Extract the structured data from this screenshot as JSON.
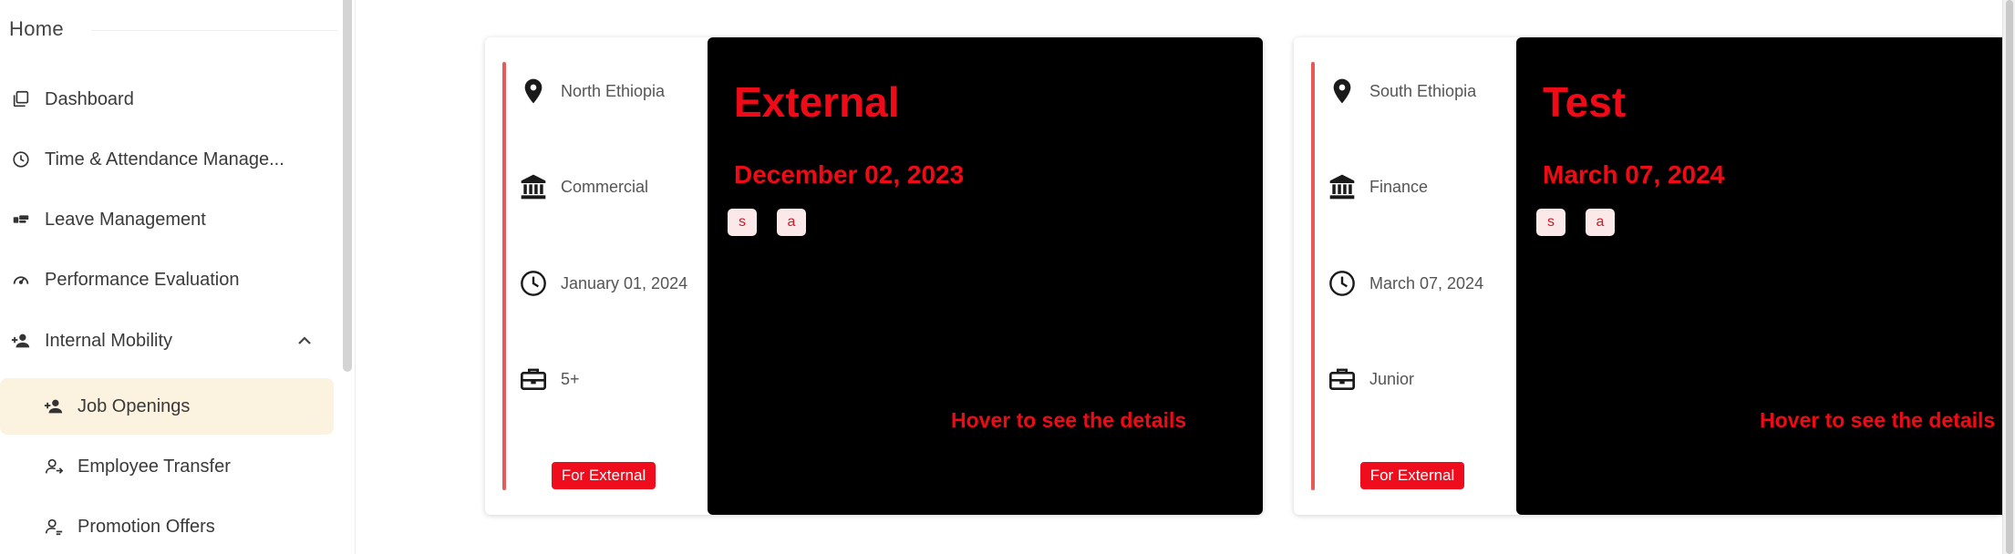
{
  "sidebar": {
    "home_label": "Home",
    "items": [
      {
        "label": "Dashboard",
        "icon": "dashboard-icon"
      },
      {
        "label": "Time & Attendance Manage...",
        "icon": "clock-icon"
      },
      {
        "label": "Leave Management",
        "icon": "leave-icon"
      },
      {
        "label": "Performance Evaluation",
        "icon": "gauge-icon"
      },
      {
        "label": "Internal Mobility",
        "icon": "person-add-icon",
        "expanded": true
      },
      {
        "label": "Job Openings",
        "icon": "person-add-icon",
        "active": true
      },
      {
        "label": "Employee Transfer",
        "icon": "person-transfer-icon"
      },
      {
        "label": "Promotion Offers",
        "icon": "person-promotion-icon"
      }
    ],
    "active_color": "#fbf3df"
  },
  "cards": [
    {
      "location": "North Ethiopia",
      "department": "Commercial",
      "deadline": "January 01, 2024",
      "experience": "5+",
      "badge": "For External",
      "title": "External",
      "posted_date": "December 02, 2023",
      "tags": [
        "s",
        "a"
      ],
      "hover_hint": "Hover to see the details"
    },
    {
      "location": "South Ethiopia",
      "department": "Finance",
      "deadline": "March 07, 2024",
      "experience": "Junior",
      "badge": "For External",
      "title": "Test",
      "posted_date": "March 07, 2024",
      "tags": [
        "s",
        "a"
      ],
      "hover_hint": "Hover to see the details"
    }
  ],
  "colors": {
    "accent_red": "#ee0a16",
    "badge_red": "#ef0c1c",
    "card_dark": "#000000",
    "accent_bar": "#e85a5a"
  }
}
